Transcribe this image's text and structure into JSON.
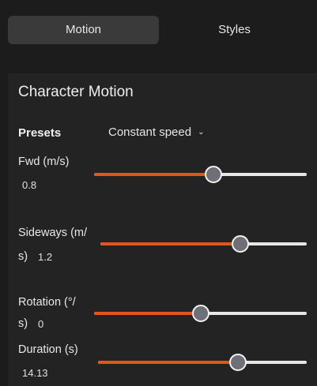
{
  "tabs": [
    {
      "label": "Motion",
      "active": true
    },
    {
      "label": "Styles",
      "active": false
    }
  ],
  "panel": {
    "title": "Character Motion",
    "presets": {
      "label": "Presets",
      "value": "Constant speed"
    },
    "sliders": [
      {
        "label": "Fwd (m/s)",
        "value": "0.8",
        "fraction": 0.56
      },
      {
        "label": "Sideways (m/",
        "label_cont": "s)",
        "value": "1.2",
        "fraction": 0.68
      },
      {
        "label": "Rotation (°/",
        "label_cont": "s)",
        "value": "0",
        "fraction": 0.5
      },
      {
        "label": "Duration (s)",
        "value": "14.13",
        "fraction": 0.67
      }
    ]
  },
  "colors": {
    "background": "#1c1c1c",
    "panel": "#232323",
    "active_tab": "#3a3a3a",
    "slider_fill": "#e4551d",
    "slider_track": "#e7e7e7",
    "slider_thumb": "#6f6f78"
  }
}
